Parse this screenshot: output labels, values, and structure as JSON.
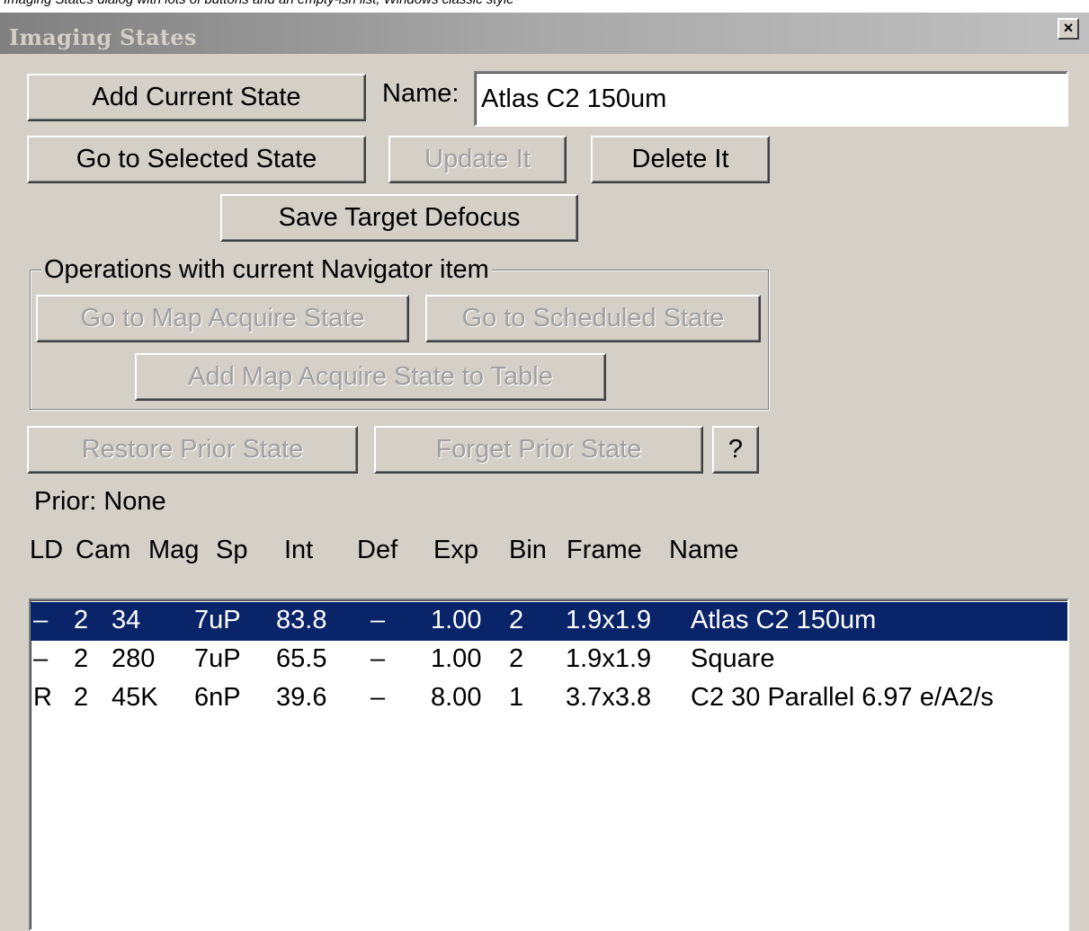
{
  "page_top_text": "Imaging States dialog with lots of buttons and an empty-ish list, Windows classic style",
  "window": {
    "title": "Imaging States",
    "close_glyph": "×"
  },
  "buttons": {
    "add_current_state": "Add Current State",
    "go_to_selected_state": "Go to Selected State",
    "update_it": "Update It",
    "delete_it": "Delete It",
    "save_target_defocus": "Save Target Defocus",
    "go_to_map_acquire_state": "Go to Map Acquire State",
    "go_to_scheduled_state": "Go to Scheduled State",
    "add_map_acquire_state_to_table": "Add Map Acquire State to Table",
    "restore_prior_state": "Restore Prior State",
    "forget_prior_state": "Forget Prior State",
    "help": "?"
  },
  "name_field": {
    "label": "Name:",
    "value": "Atlas C2 150um"
  },
  "navigator_group": {
    "label": "Operations with current Navigator item"
  },
  "prior": {
    "text": "Prior: None"
  },
  "table": {
    "columns": [
      "LD",
      "Cam",
      "Mag",
      "Sp",
      "Int",
      "Def",
      "Exp",
      "Bin",
      "Frame",
      "Name"
    ],
    "rows": [
      {
        "ld": "–",
        "cam": "2",
        "mag": "34",
        "sp": "7uP",
        "int": "83.8",
        "def": "–",
        "exp": "1.00",
        "bin": "2",
        "frame": "1.9x1.9",
        "name": "Atlas C2 150um",
        "selected": true
      },
      {
        "ld": "–",
        "cam": "2",
        "mag": "280",
        "sp": "7uP",
        "int": "65.5",
        "def": "–",
        "exp": "1.00",
        "bin": "2",
        "frame": "1.9x1.9",
        "name": "Square",
        "selected": false
      },
      {
        "ld": "R",
        "cam": "2",
        "mag": "45K",
        "sp": "6nP",
        "int": "39.6",
        "def": "–",
        "exp": "8.00",
        "bin": "1",
        "frame": "3.7x3.8",
        "name": "C2 30 Parallel 6.97 e/A2/s",
        "selected": false
      }
    ]
  },
  "colors": {
    "dialog_bg": "#d4d0c8",
    "selection_bg": "#0a246a",
    "selection_text": "#ffffff",
    "disabled_text": "#a0a0a0"
  }
}
